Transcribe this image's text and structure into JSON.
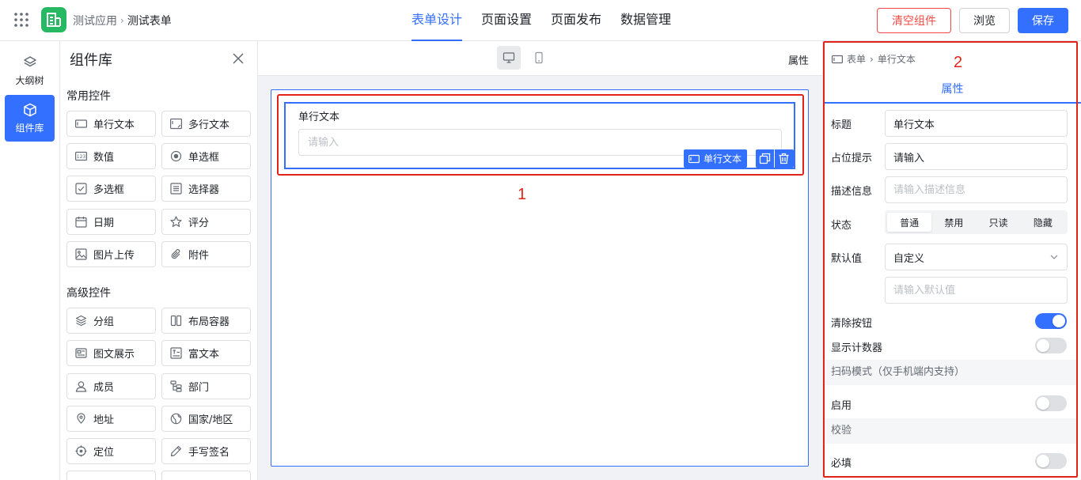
{
  "header": {
    "breadcrumb": {
      "app": "测试应用",
      "page": "测试表单"
    },
    "nav": [
      "表单设计",
      "页面设置",
      "页面发布",
      "数据管理"
    ],
    "active_nav": "表单设计",
    "buttons": {
      "clear": "清空组件",
      "preview": "浏览",
      "save": "保存"
    }
  },
  "rail": {
    "outline": "大纲树",
    "library": "组件库"
  },
  "library": {
    "title": "组件库",
    "common_title": "常用控件",
    "common": [
      {
        "label": "单行文本",
        "icon": "single-line-text-icon"
      },
      {
        "label": "多行文本",
        "icon": "multi-line-text-icon"
      },
      {
        "label": "数值",
        "icon": "number-icon"
      },
      {
        "label": "单选框",
        "icon": "radio-icon"
      },
      {
        "label": "多选框",
        "icon": "checkbox-icon"
      },
      {
        "label": "选择器",
        "icon": "select-icon"
      },
      {
        "label": "日期",
        "icon": "calendar-icon"
      },
      {
        "label": "评分",
        "icon": "star-icon"
      },
      {
        "label": "图片上传",
        "icon": "image-icon"
      },
      {
        "label": "附件",
        "icon": "paperclip-icon"
      }
    ],
    "advanced_title": "高级控件",
    "advanced": [
      {
        "label": "分组",
        "icon": "layers-icon"
      },
      {
        "label": "布局容器",
        "icon": "columns-icon"
      },
      {
        "label": "图文展示",
        "icon": "card-icon"
      },
      {
        "label": "富文本",
        "icon": "rich-text-icon"
      },
      {
        "label": "成员",
        "icon": "user-icon"
      },
      {
        "label": "部门",
        "icon": "department-icon"
      },
      {
        "label": "地址",
        "icon": "map-pin-icon"
      },
      {
        "label": "国家/地区",
        "icon": "globe-icon"
      },
      {
        "label": "定位",
        "icon": "locate-icon"
      },
      {
        "label": "手写签名",
        "icon": "signature-icon"
      }
    ]
  },
  "canvas": {
    "properties_label": "属性",
    "field": {
      "label": "单行文本",
      "placeholder": "请输入",
      "type_tag": "单行文本"
    },
    "annotation": "1"
  },
  "properties": {
    "breadcrumb": {
      "root": "表单",
      "current": "单行文本"
    },
    "tab": "属性",
    "annotation": "2",
    "title_label": "标题",
    "title_value": "单行文本",
    "placeholder_label": "占位提示",
    "placeholder_value": "请输入",
    "desc_label": "描述信息",
    "desc_placeholder": "请输入描述信息",
    "status_label": "状态",
    "status_options": [
      "普通",
      "禁用",
      "只读",
      "隐藏"
    ],
    "status_selected": "普通",
    "default_label": "默认值",
    "default_mode": "自定义",
    "default_placeholder": "请输入默认值",
    "clear_btn_label": "清除按钮",
    "clear_btn_on": true,
    "counter_label": "显示计数器",
    "counter_on": false,
    "scan_section": "扫码模式（仅手机端内支持）",
    "scan_enable_label": "启用",
    "scan_on": false,
    "validate_section": "校验",
    "required_label": "必填",
    "required_on": false
  },
  "colors": {
    "primary": "#3370ff",
    "danger": "#f54a45",
    "annotation": "#e2231a",
    "logo": "#26b862"
  }
}
